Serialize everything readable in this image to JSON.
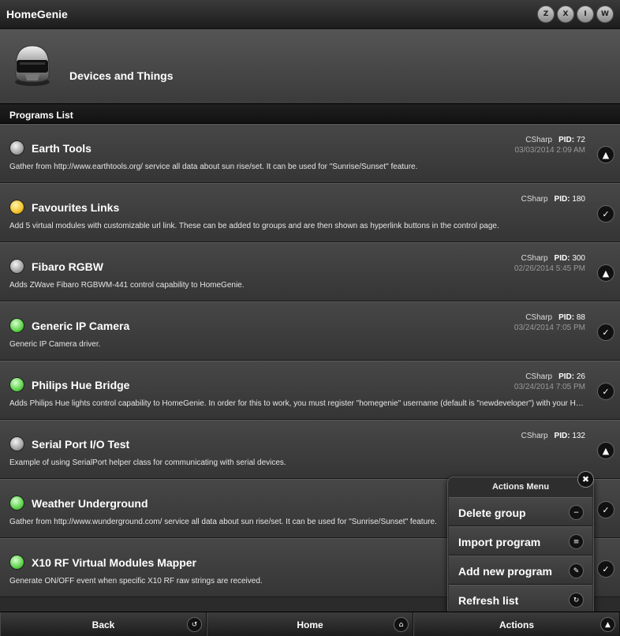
{
  "app": {
    "title": "HomeGenie"
  },
  "top_icons": [
    {
      "name": "zwave-icon",
      "glyph": "Z"
    },
    {
      "name": "x10-icon",
      "glyph": "X"
    },
    {
      "name": "insteon-icon",
      "glyph": "I"
    },
    {
      "name": "w800-icon",
      "glyph": "W"
    }
  ],
  "header": {
    "title": "Devices and Things"
  },
  "section": {
    "title": "Programs List"
  },
  "programs": [
    {
      "name": "Earth Tools",
      "desc": "Gather from http://www.earthtools.org/ service all data about sun rise/set. It can be used for \"Sunrise/Sunset\" feature.",
      "lang": "CSharp",
      "pid_label": "PID:",
      "pid": "72",
      "date": "03/03/2014 2:09 AM",
      "led": "grey",
      "action_icon": "eject-icon",
      "action_glyph": "▲"
    },
    {
      "name": "Favourites Links",
      "desc": "Add 5 virtual modules with customizable url link. These can be added to groups and are then shown as hyperlink buttons in the control page.",
      "lang": "CSharp",
      "pid_label": "PID:",
      "pid": "180",
      "date": "",
      "led": "yellow",
      "action_icon": "check-icon",
      "action_glyph": "✓"
    },
    {
      "name": "Fibaro RGBW",
      "desc": "Adds ZWave Fibaro RGBWM-441 control capability to HomeGenie.",
      "lang": "CSharp",
      "pid_label": "PID:",
      "pid": "300",
      "date": "02/26/2014 5:45 PM",
      "led": "grey",
      "action_icon": "eject-icon",
      "action_glyph": "▲"
    },
    {
      "name": "Generic IP Camera",
      "desc": "Generic IP Camera driver.",
      "lang": "CSharp",
      "pid_label": "PID:",
      "pid": "88",
      "date": "03/24/2014 7:05 PM",
      "led": "green",
      "action_icon": "check-icon",
      "action_glyph": "✓"
    },
    {
      "name": "Philips Hue Bridge",
      "desc": "Adds Philips Hue lights control capability to HomeGenie. In order for this to work, you must register \"homegenie\" username (default is \"newdeveloper\") with your Hue bridge.",
      "lang": "CSharp",
      "pid_label": "PID:",
      "pid": "26",
      "date": "03/24/2014 7:05 PM",
      "led": "green",
      "action_icon": "check-icon",
      "action_glyph": "✓"
    },
    {
      "name": "Serial Port I/O Test",
      "desc": "Example of using SerialPort helper class for communicating with serial devices.",
      "lang": "CSharp",
      "pid_label": "PID:",
      "pid": "132",
      "date": "",
      "led": "grey",
      "action_icon": "eject-icon",
      "action_glyph": "▲"
    },
    {
      "name": "Weather Underground",
      "desc": "Gather from http://www.wunderground.com/ service all data about sun rise/set. It can be used for \"Sunrise/Sunset\" feature.",
      "lang": "",
      "pid_label": "",
      "pid": "",
      "date": "",
      "led": "green",
      "action_icon": "check-icon",
      "action_glyph": "✓"
    },
    {
      "name": "X10 RF Virtual Modules Mapper",
      "desc": "Generate ON/OFF event when specific X10 RF raw strings are received.",
      "lang": "",
      "pid_label": "",
      "pid": "",
      "date": "",
      "led": "green",
      "action_icon": "check-icon",
      "action_glyph": "✓"
    }
  ],
  "actions_menu": {
    "title": "Actions Menu",
    "close_glyph": "✖",
    "items": [
      {
        "label": "Delete group",
        "icon": "minus-icon",
        "glyph": "−"
      },
      {
        "label": "Import program",
        "icon": "list-icon",
        "glyph": "≡"
      },
      {
        "label": "Add new program",
        "icon": "pencil-icon",
        "glyph": "✎"
      },
      {
        "label": "Refresh list",
        "icon": "refresh-icon",
        "glyph": "↻"
      }
    ]
  },
  "footer": {
    "back": {
      "label": "Back",
      "glyph": "↺"
    },
    "home": {
      "label": "Home",
      "glyph": "⌂"
    },
    "actions": {
      "label": "Actions",
      "glyph": "▲"
    }
  }
}
